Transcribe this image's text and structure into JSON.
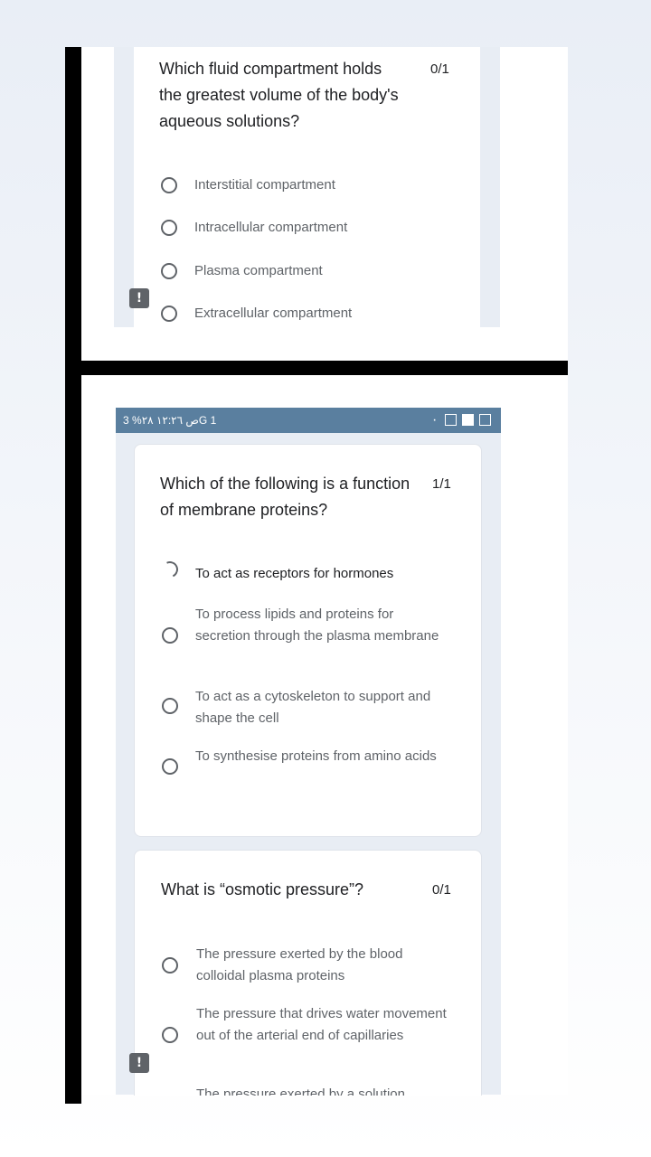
{
  "top_card": {
    "question": "Which fluid compartment holds the greatest volume of the body's aqueous solutions?",
    "score": "0/1",
    "options": [
      "Interstitial compartment",
      "Intracellular compartment",
      "Plasma compartment",
      "Extracellular compartment"
    ]
  },
  "status_bar": {
    "right_text": "ص ١٢:٢٦ ٢٨% 3G 1",
    "left_dot": "·"
  },
  "card2": {
    "question": "Which of the following is a function of membrane proteins?",
    "score": "1/1",
    "options": [
      "To act as receptors for hormones",
      "To process lipids and proteins for secretion through the plasma membrane",
      "To act as a cytoskeleton to support and shape the cell",
      "To synthesise proteins from amino acids"
    ]
  },
  "card3": {
    "question": "What is “osmotic pressure”?",
    "score": "0/1",
    "options": [
      "The pressure exerted by the blood colloidal plasma proteins",
      "The pressure that drives water movement out of the arterial end of capillaries",
      "The pressure exerted by a solution"
    ]
  },
  "icons": {
    "report": "!"
  }
}
